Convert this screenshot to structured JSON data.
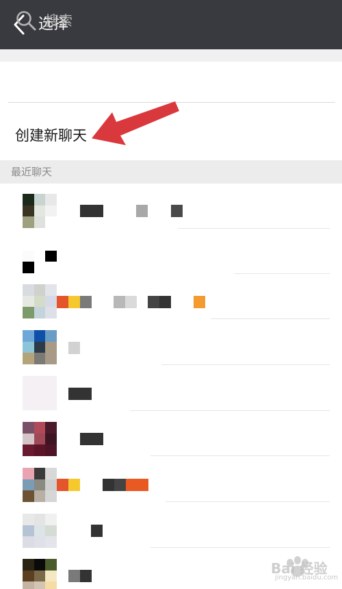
{
  "header": {
    "title": "选择",
    "back_icon": "chevron-left-icon"
  },
  "search": {
    "placeholder": "搜索",
    "icon": "search-icon"
  },
  "create_chat": {
    "label": "创建新聊天"
  },
  "recent": {
    "section_label": "最近聊天"
  },
  "watermark": {
    "text": "Bai 经验",
    "sub": "jingyan.baidu.com"
  },
  "colors": {
    "header_bg": "#393a3f",
    "arrow": "#d9383d",
    "section_bg": "#ececec",
    "placeholder": "#b2b2b2"
  }
}
